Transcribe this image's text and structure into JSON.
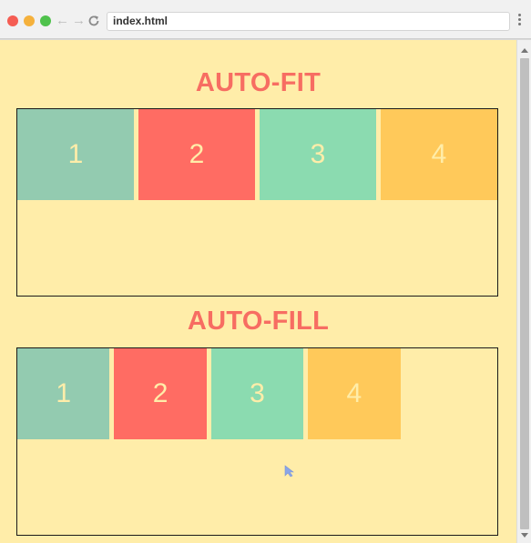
{
  "browser": {
    "tab_url": "index.html",
    "icons": {
      "back": "←",
      "forward": "→",
      "reload": "C"
    }
  },
  "page": {
    "autofit": {
      "title": "AUTO-FIT",
      "items": [
        "1",
        "2",
        "3",
        "4"
      ]
    },
    "autofill": {
      "title": "AUTO-FILL",
      "items": [
        "1",
        "2",
        "3",
        "4"
      ]
    }
  },
  "colors": {
    "background": "#ffeda9",
    "heading": "#f76d62",
    "tile_1": "#93cbb0",
    "tile_2": "#ff6c63",
    "tile_3": "#8bdbb0",
    "tile_4": "#ffc95a",
    "tile_text": "#ffeda9"
  }
}
